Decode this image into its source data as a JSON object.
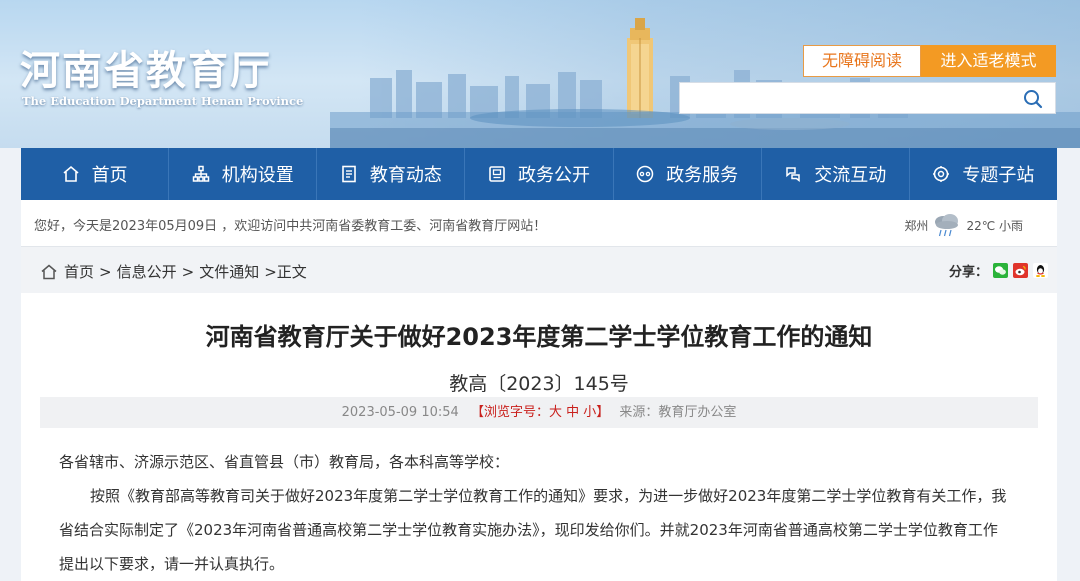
{
  "header": {
    "logo_cn": "河南省教育厅",
    "logo_en": "The Education Department Henan Province",
    "accessibility_label": "无障碍阅读",
    "elder_mode_label": "进入适老模式",
    "search_placeholder": ""
  },
  "nav": {
    "items": [
      {
        "label": "首页",
        "icon": "home-icon"
      },
      {
        "label": "机构设置",
        "icon": "org-icon"
      },
      {
        "label": "教育动态",
        "icon": "news-icon"
      },
      {
        "label": "政务公开",
        "icon": "gov-open-icon"
      },
      {
        "label": "政务服务",
        "icon": "service-icon"
      },
      {
        "label": "交流互动",
        "icon": "interact-icon"
      },
      {
        "label": "专题子站",
        "icon": "topic-icon"
      }
    ]
  },
  "welcome": {
    "text": "您好，今天是2023年05月09日 ，欢迎访问中共河南省委教育工委、河南省教育厅网站！",
    "weather_city": "郑州",
    "weather_temp": "22℃ 小雨"
  },
  "breadcrumb": {
    "items": [
      "首页",
      "信息公开",
      "文件通知"
    ],
    "current": ">正文",
    "share_label": "分享："
  },
  "article": {
    "title": "河南省教育厅关于做好2023年度第二学士学位教育工作的通知",
    "doc_number": "教高〔2023〕145号",
    "datetime": "2023-05-09 10:54",
    "font_size_label": "【浏览字号：大 中 小】",
    "source": "来源：教育厅办公室",
    "salutation": "各省辖市、济源示范区、省直管县（市）教育局，各本科高等学校：",
    "para1_line1": "按照《教育部高等教育司关于做好2023年度第二学士学位教育工作的通知》要求，为进一步做好2023年度第二学士学位教育有关工作，我",
    "para1_line2": "省结合实际制定了《2023年河南省普通高校第二学士学位教育实施办法》，现印发给你们。并就2023年河南省普通高校第二学士学位教育工作",
    "para1_line3": "提出以下要求，请一并认真执行。"
  },
  "colors": {
    "nav_bg": "#1f5fa6",
    "elder_btn": "#f39a23",
    "accessibility_text": "#e8761d",
    "font_size_red": "#c9201c"
  }
}
